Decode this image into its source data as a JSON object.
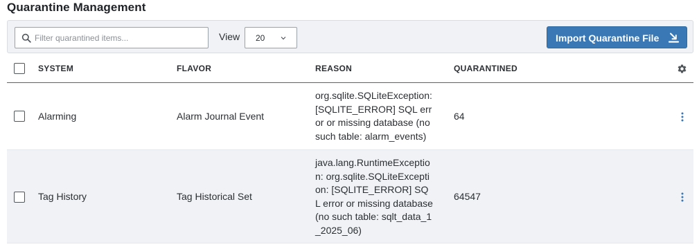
{
  "page": {
    "title": "Quarantine Management"
  },
  "toolbar": {
    "search_placeholder": "Filter quarantined items...",
    "search_value": "",
    "view_label": "View",
    "view_value": "20",
    "import_label": "Import Quarantine File"
  },
  "table": {
    "columns": [
      "SYSTEM",
      "FLAVOR",
      "REASON",
      "QUARANTINED"
    ],
    "rows": [
      {
        "system": "Alarming",
        "flavor": "Alarm Journal Event",
        "reason": "org.sqlite.SQLiteException: [SQLITE_ERROR] SQL error or missing database (no such table: alarm_events)",
        "quarantined": "64"
      },
      {
        "system": "Tag History",
        "flavor": "Tag Historical Set",
        "reason": "java.lang.RuntimeException: org.sqlite.SQLiteException: [SQLITE_ERROR] SQL error or missing database (no such table: sqlt_data_1_2025_06)",
        "quarantined": "64547"
      }
    ]
  },
  "icons": {
    "search": "search-icon",
    "view_dropdown": "chevron-down-icon",
    "import": "import-icon",
    "columns_settings": "gear-icon",
    "row_menu": "kebab-icon"
  },
  "colors": {
    "accent": "#3a78b5",
    "toolbar_bg": "#f0f2f5",
    "alt_row_bg": "#f0f2f5",
    "text": "#2b2f33"
  }
}
